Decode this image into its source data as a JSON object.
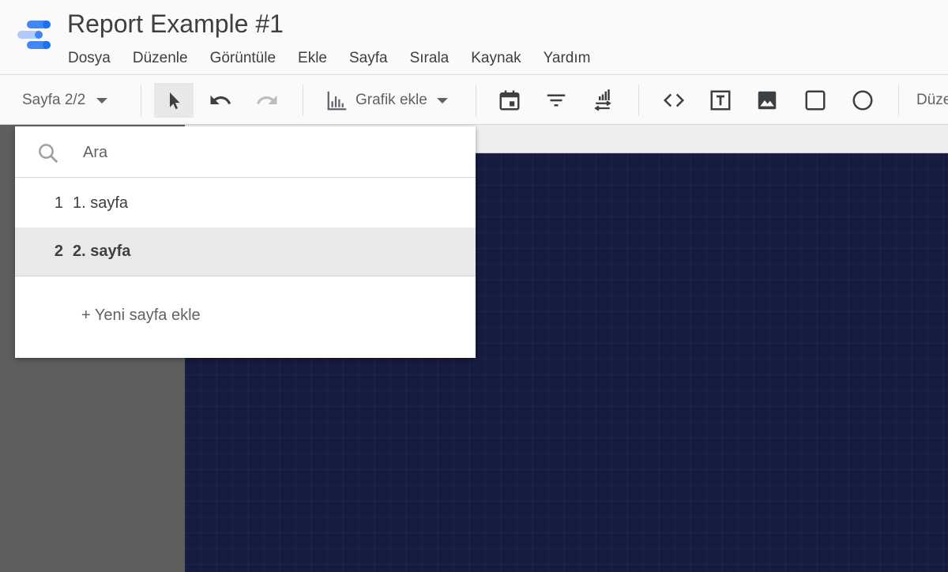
{
  "app": {
    "title": "Report Example #1",
    "logo_icon": "data-studio-logo-icon",
    "brand_colors": [
      "#4285f4",
      "#1a73e8",
      "#aecbfa"
    ]
  },
  "menu": {
    "items": [
      "Dosya",
      "Düzenle",
      "Görüntüle",
      "Ekle",
      "Sayfa",
      "Sırala",
      "Kaynak",
      "Yardım"
    ]
  },
  "toolbar": {
    "page_selector": "Sayfa 2/2",
    "add_chart_label": "Grafik ekle",
    "cut_label": "Düze",
    "icons": [
      "select-pointer-icon",
      "undo-icon",
      "redo-icon",
      "bar-chart-icon",
      "date-range-icon",
      "filter-icon",
      "data-control-icon",
      "embed-code-icon",
      "text-box-icon",
      "image-icon",
      "rectangle-icon",
      "circle-icon"
    ]
  },
  "page_dropdown": {
    "search_placeholder": "Ara",
    "pages": [
      {
        "number": "1",
        "name": "1. sayfa",
        "selected": false
      },
      {
        "number": "2",
        "name": "2. sayfa",
        "selected": true
      }
    ],
    "add_page_label": "+ Yeni sayfa ekle"
  },
  "colors": {
    "canvas_background": "#161b40",
    "workspace_gray": "#5e5e5e",
    "toolbar_background": "#fafafa",
    "selected_row": "#e9e9e9"
  }
}
